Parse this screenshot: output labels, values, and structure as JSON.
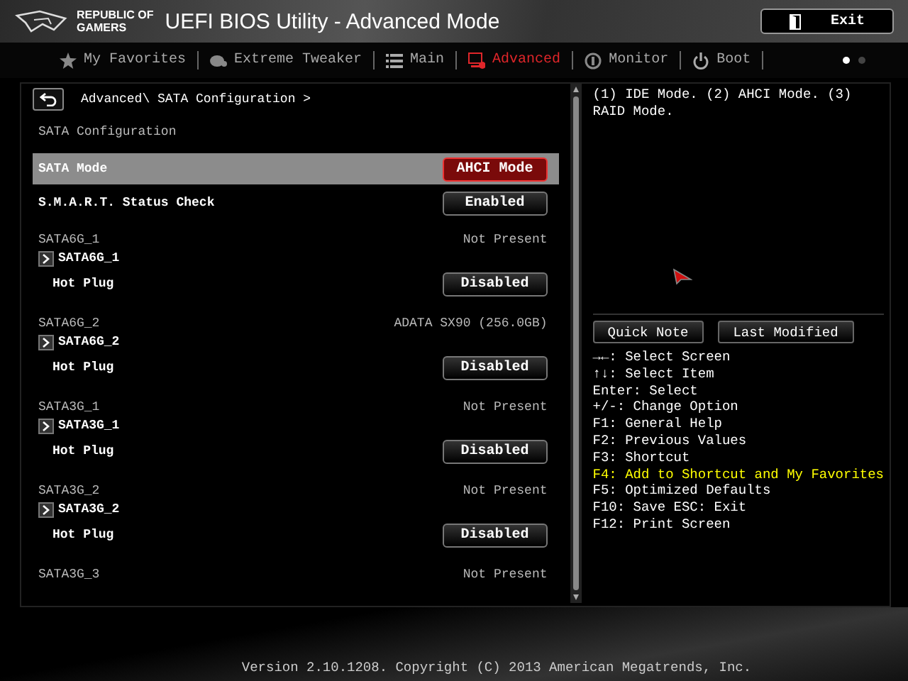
{
  "header": {
    "logo_lines": [
      "REPUBLIC OF",
      "GAMERS"
    ],
    "title": "UEFI BIOS Utility - Advanced Mode",
    "exit_button": "Exit"
  },
  "tabs": [
    {
      "label": "My Favorites",
      "selected": false
    },
    {
      "label": "Extreme Tweaker",
      "selected": false
    },
    {
      "label": "Main",
      "selected": false
    },
    {
      "label": "Advanced",
      "selected": true
    },
    {
      "label": "Monitor",
      "selected": false
    },
    {
      "label": "Boot",
      "selected": false
    }
  ],
  "page_dots": [
    {
      "selected": true
    },
    {
      "selected": false
    }
  ],
  "breadcrumb": "Advanced\\ SATA Configuration >",
  "settings": [
    {
      "kind": "title",
      "label": "SATA Configuration"
    },
    {
      "kind": "setting",
      "label": "SATA Mode",
      "value": "AHCI Mode",
      "selected": true
    },
    {
      "kind": "setting",
      "label": "S.M.A.R.T. Status Check",
      "value": "Enabled",
      "selected": false
    },
    {
      "kind": "device",
      "label": "SATA6G_1",
      "value": "Not Present"
    },
    {
      "kind": "submenu",
      "label": "SATA6G_1"
    },
    {
      "kind": "subsetting",
      "label": "Hot Plug",
      "value": "Disabled",
      "selected": false
    },
    {
      "kind": "device",
      "label": "SATA6G_2",
      "value": "ADATA SX90 (256.0GB)"
    },
    {
      "kind": "submenu",
      "label": "SATA6G_2"
    },
    {
      "kind": "subsetting",
      "label": "Hot Plug",
      "value": "Disabled",
      "selected": false
    },
    {
      "kind": "device",
      "label": "SATA3G_1",
      "value": "Not Present"
    },
    {
      "kind": "submenu",
      "label": "SATA3G_1"
    },
    {
      "kind": "subsetting",
      "label": "Hot Plug",
      "value": "Disabled",
      "selected": false
    },
    {
      "kind": "device",
      "label": "SATA3G_2",
      "value": "Not Present"
    },
    {
      "kind": "submenu",
      "label": "SATA3G_2"
    },
    {
      "kind": "subsetting",
      "label": "Hot Plug",
      "value": "Disabled",
      "selected": false
    },
    {
      "kind": "device",
      "label": "SATA3G_3",
      "value": "Not Present"
    }
  ],
  "help_text": "(1) IDE Mode. (2) AHCI Mode. (3) RAID Mode.",
  "side_buttons": [
    "Quick Note",
    "Last Modified"
  ],
  "key_help": [
    {
      "text": "→←: Select Screen",
      "highlighted": false
    },
    {
      "text": "↑↓: Select Item",
      "highlighted": false
    },
    {
      "text": "Enter: Select",
      "highlighted": false
    },
    {
      "text": "+/-: Change Option",
      "highlighted": false
    },
    {
      "text": "F1: General Help",
      "highlighted": false
    },
    {
      "text": "F2: Previous Values",
      "highlighted": false
    },
    {
      "text": "F3: Shortcut",
      "highlighted": false
    },
    {
      "text": "F4: Add to Shortcut and My Favorites",
      "highlighted": true
    },
    {
      "text": "F5: Optimized Defaults",
      "highlighted": false
    },
    {
      "text": "F10: Save  ESC: Exit",
      "highlighted": false
    },
    {
      "text": "F12: Print Screen",
      "highlighted": false
    }
  ],
  "footer": "Version 2.10.1208. Copyright (C) 2013 American Megatrends, Inc."
}
